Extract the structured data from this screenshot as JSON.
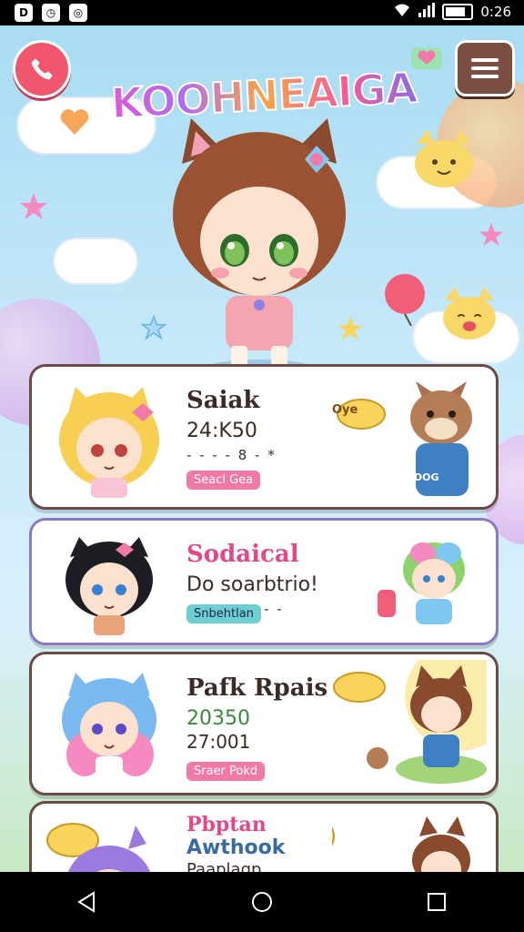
{
  "status": {
    "time": "0:26"
  },
  "app": {
    "title": "KOOHNEAIGA"
  },
  "cards": [
    {
      "name": "Saiak",
      "line2": "24:K50",
      "line3": "- - - - 8 - *",
      "tag": "Seacl Gea",
      "bubble": "Oye",
      "side_label": "DOG"
    },
    {
      "name": "Sodaical",
      "line2": "Do soarbtrio!",
      "line3": "- - - - - - - -",
      "tag": "Snbehtlan"
    },
    {
      "name": "Pafk Rpais",
      "line2": "20350",
      "line3": "27:001",
      "tag": "Sraer Pokd"
    },
    {
      "name": "Pbptan",
      "line2": "Awthook",
      "line3": "Paaplagp"
    }
  ]
}
